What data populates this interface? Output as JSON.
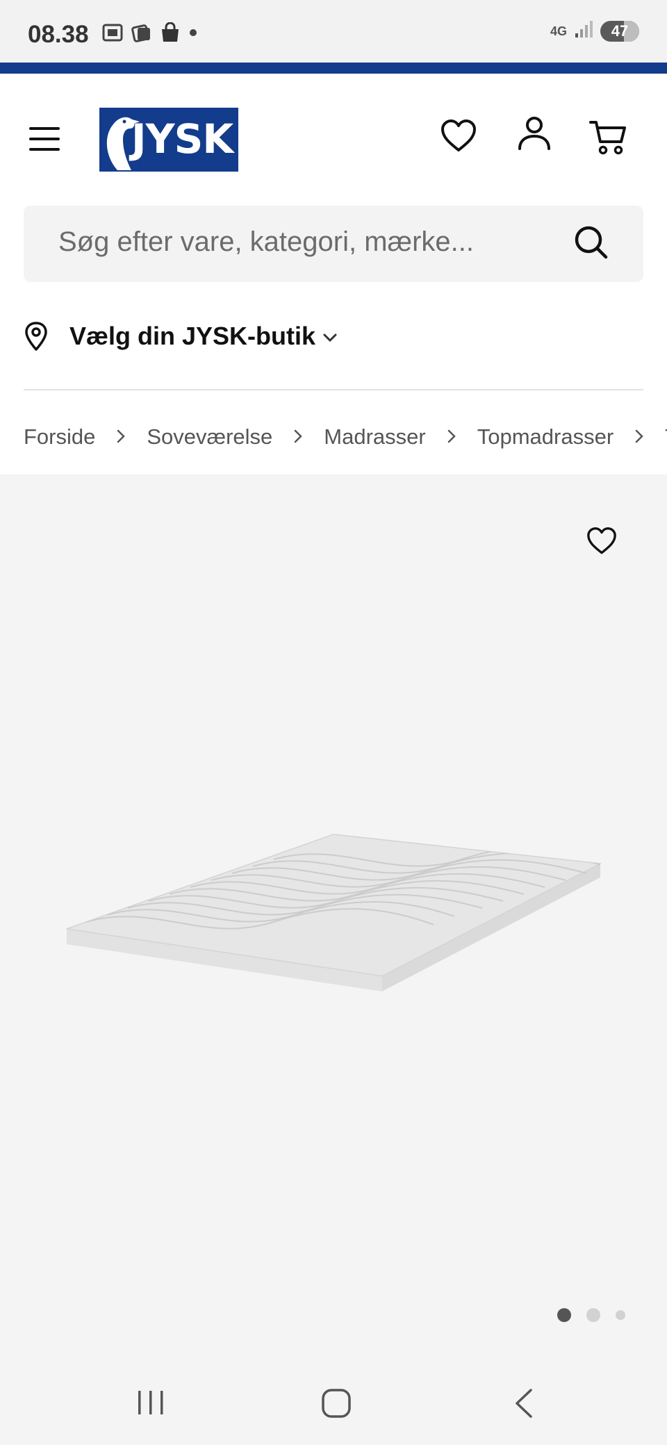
{
  "status": {
    "time": "08.38",
    "network": "4G",
    "battery": "47",
    "icons": [
      "screenshot-icon",
      "photos-icon",
      "shopping-bag-icon",
      "dot-icon",
      "signal-icon"
    ]
  },
  "header": {
    "logo_text": "JYSK",
    "icons": [
      "menu-icon",
      "heart-icon",
      "user-icon",
      "cart-icon"
    ],
    "brand_color": "#143c8c"
  },
  "search": {
    "placeholder": "Søg efter vare, kategori, mærke..."
  },
  "store": {
    "label": "Vælg din JYSK-butik"
  },
  "breadcrumb": {
    "items": [
      "Forside",
      "Soveværelse",
      "Madrasser",
      "Topmadrasser",
      "To"
    ]
  },
  "gallery": {
    "image": "mattress-topper",
    "slide_count": 3,
    "active_slide": 1
  },
  "navigation": {
    "buttons": [
      "recent-apps",
      "home",
      "back"
    ]
  }
}
